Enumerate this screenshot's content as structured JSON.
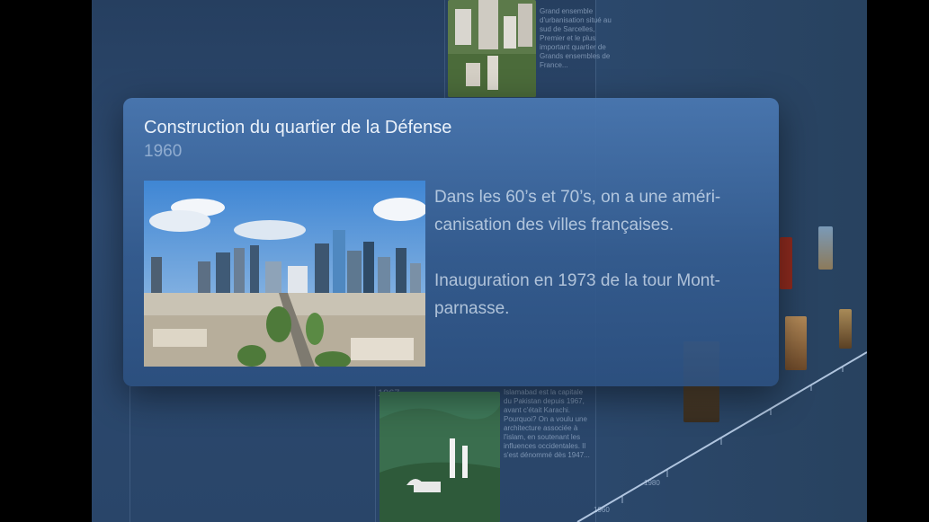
{
  "card": {
    "title": "Construction du quartier de la Défense",
    "year": "1960",
    "image_alt": "La Défense skyline",
    "paragraphs": [
      "Dans les 60’s et 70’s, on a une améri-canisation des villes françaises.",
      "Inauguration en 1973 de la tour Mont-parnasse."
    ]
  },
  "background": {
    "top_text": "Grand ensemble d'urbanisation situé au sud de Sarcelles, Premier et le plus important quartier de Grands ensembles de France...",
    "year_1967": "1967",
    "mosque_text": "Islamabad est la capitale du Pakistan depuis 1967, avant c'était Karachi. Pourquoi? On a voulu une architecture associée à l'islam, en soutenant les influences occidentales. Il s'est dénommé dès 1947...",
    "axis_years": [
      "1960",
      "1980"
    ]
  },
  "colors": {
    "card_top": "#4a78b2",
    "card_bottom": "#2c5080",
    "stage": "#2d4a70"
  }
}
